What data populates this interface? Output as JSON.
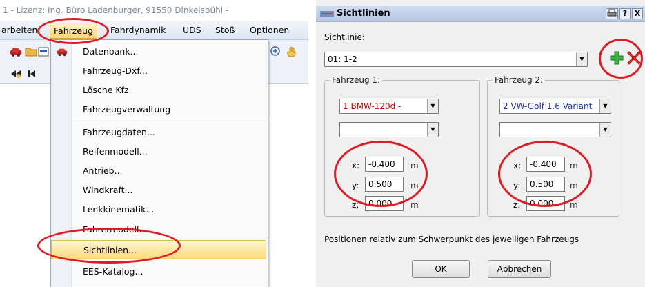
{
  "left": {
    "title_text": "1 - Lizenz: Ing. Büro Ladenburger, 91550 Dinkelsbühl -",
    "menubar": [
      {
        "label": "arbeiten"
      },
      {
        "label": "Fahrzeug"
      },
      {
        "label": "Fahrdynamik"
      },
      {
        "label": "UDS"
      },
      {
        "label": "Stoß"
      },
      {
        "label": "Optionen"
      }
    ],
    "dropdown": [
      {
        "label": "Datenbank..."
      },
      {
        "label": "Fahrzeug-Dxf..."
      },
      {
        "label": "Lösche Kfz"
      },
      {
        "label": "Fahrzeugverwaltung"
      },
      {
        "label": "Fahrzeugdaten..."
      },
      {
        "label": "Reifenmodell..."
      },
      {
        "label": "Antrieb..."
      },
      {
        "label": "Windkraft..."
      },
      {
        "label": "Lenkkinematik..."
      },
      {
        "label": "Fahrermodell..."
      },
      {
        "label": "Sichtlinien..."
      },
      {
        "label": "EES-Katalog..."
      }
    ],
    "toolbar_icons": [
      "car-icon",
      "open-folder-icon",
      "dxf-icon",
      "zoom-icon",
      "hand-icon",
      "rewind-icon",
      "first-frame-icon"
    ]
  },
  "dialog": {
    "title": "Sichtlinien",
    "title_buttons": [
      "print-icon",
      "?",
      "X"
    ],
    "sichtlinie_label": "Sichtlinie:",
    "sichtlinie_value": "01: 1-2",
    "add_icon": "plus-icon",
    "delete_icon": "delete-x-icon",
    "vehicle1": {
      "group_label": "Fahrzeug 1:",
      "vehicle": "1  BMW-120d -",
      "second": "",
      "x": "-0.400",
      "y": "0.500",
      "z": "0.000",
      "unit": "m",
      "value_color": "#cc0000"
    },
    "vehicle2": {
      "group_label": "Fahrzeug 2:",
      "vehicle": "2  VW-Golf 1.6 Variant",
      "second": "",
      "x": "-0.400",
      "y": "0.500",
      "z": "0.000",
      "unit": "m",
      "value_color": "#1a2fbf"
    },
    "axis_labels": {
      "x": "x:",
      "y": "y:",
      "z": "z:"
    },
    "hint": "Positionen relativ zum Schwerpunkt des jeweiligen Fahrzeugs",
    "ok_label": "OK",
    "cancel_label": "Abbrechen"
  },
  "colors": {
    "menu_highlight": "#fcd679",
    "annotation": "#e01b24",
    "dialog_bg": "#f0f0f0"
  }
}
